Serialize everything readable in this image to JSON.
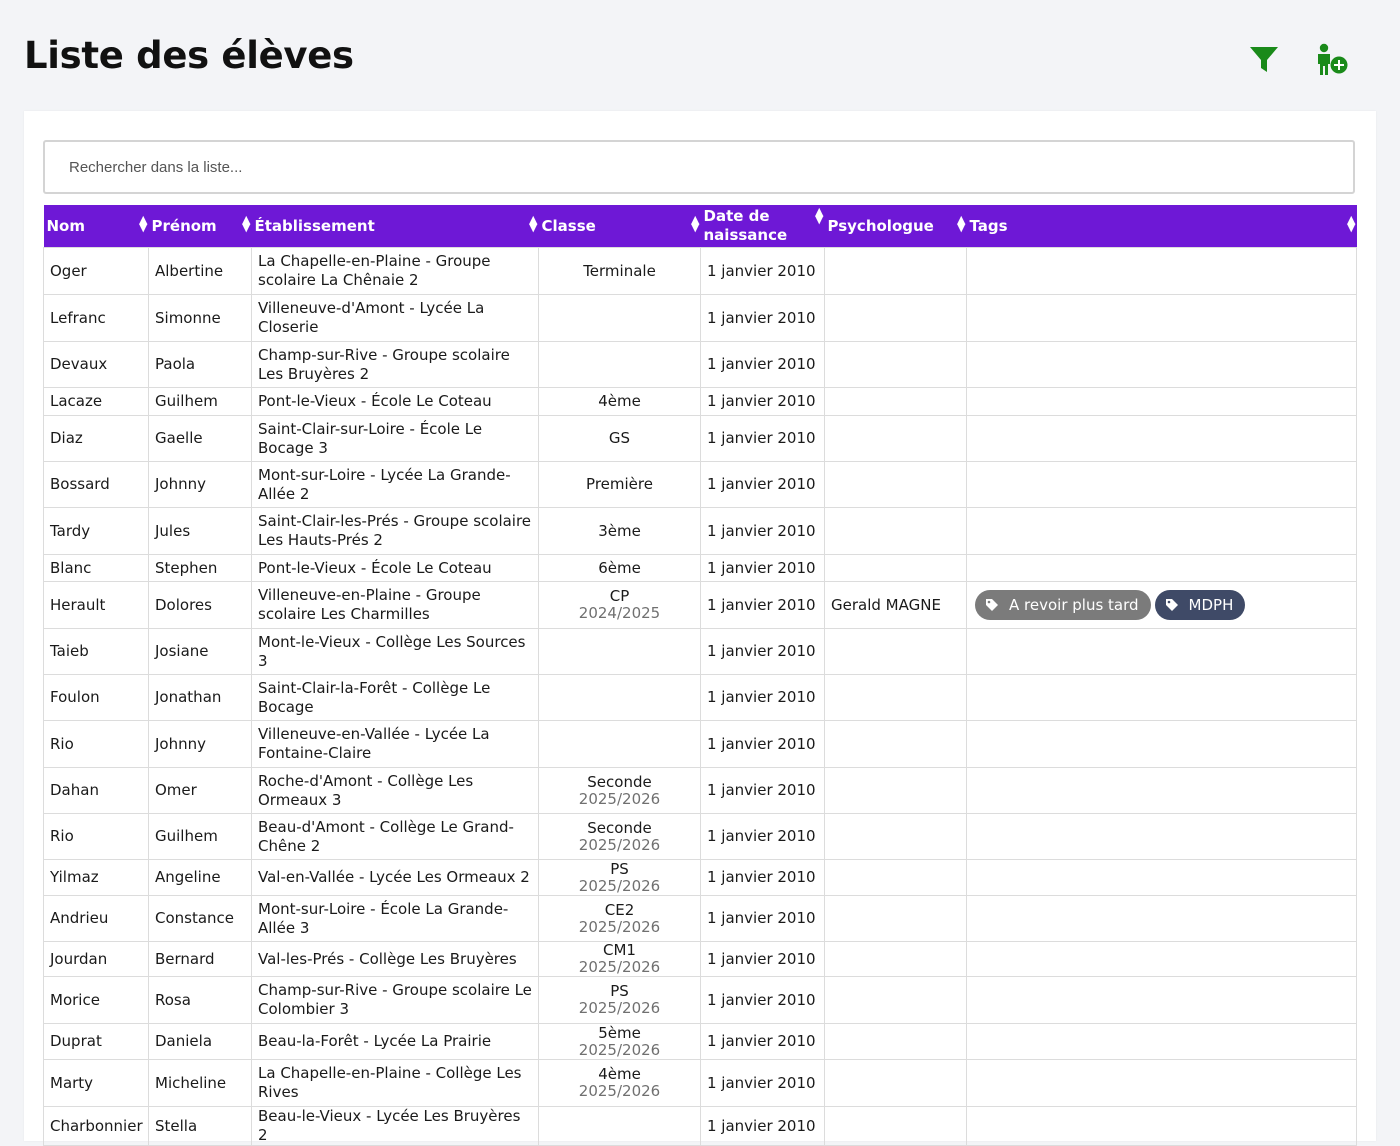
{
  "page": {
    "title": "Liste des élèves",
    "filter_icon": "filter-icon",
    "add_icon": "add-person-icon"
  },
  "search": {
    "placeholder": "Rechercher dans la liste..."
  },
  "colors": {
    "header_bg": "#6e18d6",
    "icon_green": "#1a8a1a",
    "tag_revoir": "#7b7b7b",
    "tag_mdph": "#3f4a67"
  },
  "columns": [
    {
      "label": "Nom",
      "icon": "sort-icon"
    },
    {
      "label": "Prénom",
      "icon": "sort-icon"
    },
    {
      "label": "Établissement",
      "icon": "sort-icon"
    },
    {
      "label": "Classe",
      "icon": "sort-icon"
    },
    {
      "label": "Date de naissance",
      "icon": "sort-icon"
    },
    {
      "label": "Psychologue",
      "icon": "sort-icon"
    },
    {
      "label": "Tags",
      "icon": "sort-icon"
    }
  ],
  "rows": [
    {
      "nom": "Oger",
      "prenom": "Albertine",
      "etab": "La Chapelle-en-Plaine - Groupe scolaire La Chênaie 2",
      "classe": "Terminale",
      "annee": "",
      "naissance": "1 janvier 2010",
      "psy": "",
      "tags": []
    },
    {
      "nom": "Lefranc",
      "prenom": "Simonne",
      "etab": "Villeneuve-d'Amont - Lycée La Closerie",
      "classe": "",
      "annee": "",
      "naissance": "1 janvier 2010",
      "psy": "",
      "tags": []
    },
    {
      "nom": "Devaux",
      "prenom": "Paola",
      "etab": "Champ-sur-Rive - Groupe scolaire Les Bruyères 2",
      "classe": "",
      "annee": "",
      "naissance": "1 janvier 2010",
      "psy": "",
      "tags": []
    },
    {
      "nom": "Lacaze",
      "prenom": "Guilhem",
      "etab": "Pont-le-Vieux - École Le Coteau",
      "classe": "4ème",
      "annee": "",
      "naissance": "1 janvier 2010",
      "psy": "",
      "tags": []
    },
    {
      "nom": "Diaz",
      "prenom": "Gaelle",
      "etab": "Saint-Clair-sur-Loire - École Le Bocage 3",
      "classe": "GS",
      "annee": "",
      "naissance": "1 janvier 2010",
      "psy": "",
      "tags": []
    },
    {
      "nom": "Bossard",
      "prenom": "Johnny",
      "etab": "Mont-sur-Loire - Lycée La Grande-Allée 2",
      "classe": "Première",
      "annee": "",
      "naissance": "1 janvier 2010",
      "psy": "",
      "tags": []
    },
    {
      "nom": "Tardy",
      "prenom": "Jules",
      "etab": "Saint-Clair-les-Prés - Groupe scolaire Les Hauts-Prés 2",
      "classe": "3ème",
      "annee": "",
      "naissance": "1 janvier 2010",
      "psy": "",
      "tags": []
    },
    {
      "nom": "Blanc",
      "prenom": "Stephen",
      "etab": "Pont-le-Vieux - École Le Coteau",
      "classe": "6ème",
      "annee": "",
      "naissance": "1 janvier 2010",
      "psy": "",
      "tags": []
    },
    {
      "nom": "Herault",
      "prenom": "Dolores",
      "etab": "Villeneuve-en-Plaine - Groupe scolaire Les Charmilles",
      "classe": "CP",
      "annee": "2024/2025",
      "naissance": "1 janvier 2010",
      "psy": "Gerald MAGNE",
      "tags": [
        {
          "label": "A revoir plus tard",
          "icon": "tag-icon",
          "color": "#7b7b7b"
        },
        {
          "label": "MDPH",
          "icon": "tag-icon",
          "color": "#3f4a67"
        }
      ]
    },
    {
      "nom": "Taieb",
      "prenom": "Josiane",
      "etab": "Mont-le-Vieux - Collège Les Sources 3",
      "classe": "",
      "annee": "",
      "naissance": "1 janvier 2010",
      "psy": "",
      "tags": []
    },
    {
      "nom": "Foulon",
      "prenom": "Jonathan",
      "etab": "Saint-Clair-la-Forêt - Collège Le Bocage",
      "classe": "",
      "annee": "",
      "naissance": "1 janvier 2010",
      "psy": "",
      "tags": []
    },
    {
      "nom": "Rio",
      "prenom": "Johnny",
      "etab": "Villeneuve-en-Vallée - Lycée La Fontaine-Claire",
      "classe": "",
      "annee": "",
      "naissance": "1 janvier 2010",
      "psy": "",
      "tags": []
    },
    {
      "nom": "Dahan",
      "prenom": "Omer",
      "etab": "Roche-d'Amont - Collège Les Ormeaux 3",
      "classe": "Seconde",
      "annee": "2025/2026",
      "naissance": "1 janvier 2010",
      "psy": "",
      "tags": []
    },
    {
      "nom": "Rio",
      "prenom": "Guilhem",
      "etab": "Beau-d'Amont - Collège Le Grand-Chêne 2",
      "classe": "Seconde",
      "annee": "2025/2026",
      "naissance": "1 janvier 2010",
      "psy": "",
      "tags": []
    },
    {
      "nom": "Yilmaz",
      "prenom": "Angeline",
      "etab": "Val-en-Vallée - Lycée Les Ormeaux 2",
      "classe": "PS",
      "annee": "2025/2026",
      "naissance": "1 janvier 2010",
      "psy": "",
      "tags": []
    },
    {
      "nom": "Andrieu",
      "prenom": "Constance",
      "etab": "Mont-sur-Loire - École La Grande-Allée 3",
      "classe": "CE2",
      "annee": "2025/2026",
      "naissance": "1 janvier 2010",
      "psy": "",
      "tags": []
    },
    {
      "nom": "Jourdan",
      "prenom": "Bernard",
      "etab": "Val-les-Prés - Collège Les Bruyères",
      "classe": "CM1",
      "annee": "2025/2026",
      "naissance": "1 janvier 2010",
      "psy": "",
      "tags": []
    },
    {
      "nom": "Morice",
      "prenom": "Rosa",
      "etab": "Champ-sur-Rive - Groupe scolaire Le Colombier 3",
      "classe": "PS",
      "annee": "2025/2026",
      "naissance": "1 janvier 2010",
      "psy": "",
      "tags": []
    },
    {
      "nom": "Duprat",
      "prenom": "Daniela",
      "etab": "Beau-la-Forêt - Lycée La Prairie",
      "classe": "5ème",
      "annee": "2025/2026",
      "naissance": "1 janvier 2010",
      "psy": "",
      "tags": []
    },
    {
      "nom": "Marty",
      "prenom": "Micheline",
      "etab": "La Chapelle-en-Plaine - Collège Les Rives",
      "classe": "4ème",
      "annee": "2025/2026",
      "naissance": "1 janvier 2010",
      "psy": "",
      "tags": []
    },
    {
      "nom": "Charbonnier",
      "prenom": "Stella",
      "etab": "Beau-le-Vieux - Lycée Les Bruyères 2",
      "classe": "",
      "annee": "",
      "naissance": "1 janvier 2010",
      "psy": "",
      "tags": []
    }
  ]
}
